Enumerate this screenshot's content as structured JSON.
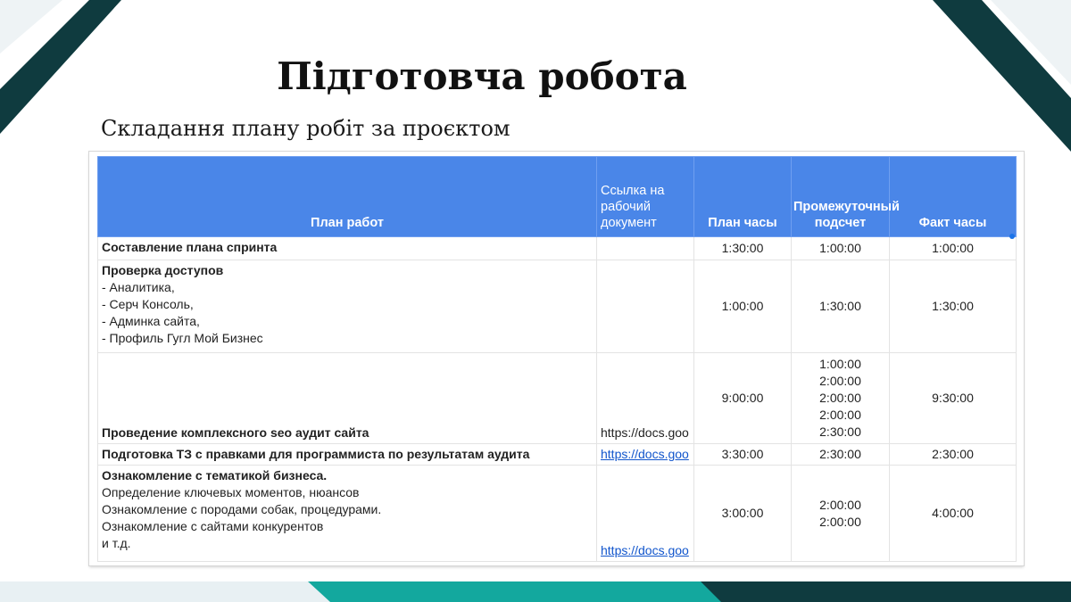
{
  "slide": {
    "title": "Підготовча робота",
    "subtitle": "Складання плану робіт за проєктом"
  },
  "table": {
    "headers": {
      "plan": "План работ",
      "link": "Ссылка на рабочий документ",
      "plan_hours": "План часы",
      "interim": "Промежуточный подсчет",
      "fact": "Факт часы"
    },
    "rows": [
      {
        "title": "Составление плана спринта",
        "lines": [],
        "link": "",
        "plan_hours": "1:30:00",
        "interim": [
          "1:00:00"
        ],
        "fact": "1:00:00"
      },
      {
        "title": "Проверка доступов",
        "lines": [
          "- Аналитика,",
          "- Серч Консоль,",
          "- Админка сайта,",
          "- Профиль Гугл Мой Бизнес"
        ],
        "link": "",
        "plan_hours": "1:00:00",
        "interim": [
          "1:30:00"
        ],
        "fact": "1:30:00"
      },
      {
        "title": "Проведение комплексного seo аудит сайта",
        "lines": [],
        "link": "https://docs.goo",
        "plan_hours": "9:00:00",
        "interim": [
          "1:00:00",
          "2:00:00",
          "2:00:00",
          "2:00:00",
          "2:30:00"
        ],
        "fact": "9:30:00"
      },
      {
        "title": "Подготовка ТЗ с правками для программиста по результатам аудита",
        "lines": [],
        "link": "https://docs.goo",
        "plan_hours": "3:30:00",
        "interim": [
          "2:30:00"
        ],
        "fact": "2:30:00"
      },
      {
        "title": "Ознакомление с тематикой бизнеса.",
        "lines": [
          "Определение ключевых моментов, нюансов",
          "Ознакомление с породами собак, процедурами.",
          "Ознакомление с сайтами конкурентов",
          "и т.д."
        ],
        "link": "https://docs.goo",
        "plan_hours": "3:00:00",
        "interim": [
          "2:00:00",
          "2:00:00"
        ],
        "fact": "4:00:00"
      }
    ]
  },
  "colors": {
    "header_blue": "#4a86e8",
    "link_blue": "#1155cc",
    "deco_dark": "#0f3b3f",
    "deco_teal": "#13a89e"
  }
}
